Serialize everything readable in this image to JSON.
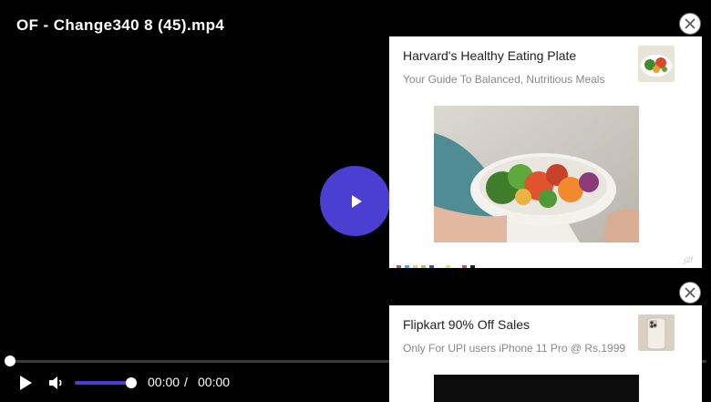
{
  "player": {
    "title": "OF - Change340 8 (45).mp4",
    "current_time": "00:00",
    "separator": "/",
    "duration": "00:00",
    "seek_fraction": 0.0,
    "volume_fraction": 1.0,
    "accent_color": "#4a3fd0"
  },
  "ads": [
    {
      "title": "Harvard's Healthy Eating Plate",
      "subtitle": "Your Guide To Balanced, Nutritious Meals",
      "tag": "j2f",
      "thumb_icon": "salad-bowl-image",
      "image_icon": "healthy-bowl-photo",
      "close_icon": "close-icon"
    },
    {
      "title": "Flipkart 90% Off Sales",
      "subtitle": "Only For UPI users iPhone 11 Pro @ Rs.1999",
      "thumb_icon": "iphone-image",
      "close_icon": "close-icon"
    }
  ]
}
